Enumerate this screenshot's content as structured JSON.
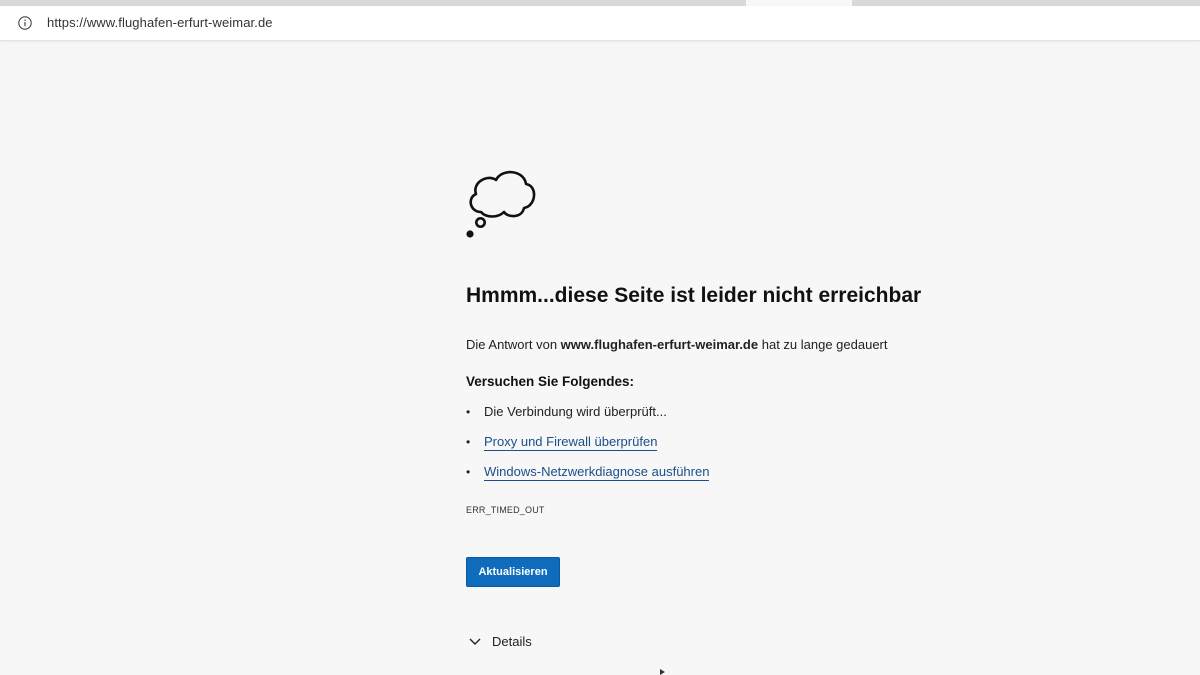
{
  "browser": {
    "url": "https://www.flughafen-erfurt-weimar.de",
    "info_icon": "info-circle-icon"
  },
  "error_page": {
    "icon": "thought-cloud-icon",
    "heading": "Hmmm...diese Seite ist leider nicht erreichbar",
    "message_prefix": "Die Antwort von",
    "message_host": "www.flughafen-erfurt-weimar.de",
    "message_suffix": "hat zu lange gedauert",
    "try_heading": "Versuchen Sie Folgendes:",
    "suggestions": [
      {
        "text": "Die Verbindung wird überprüft...",
        "link": false
      },
      {
        "text": "Proxy und Firewall überprüfen",
        "link": true
      },
      {
        "text": "Windows-Netzwerkdiagnose ausführen",
        "link": true
      }
    ],
    "error_code": "ERR_TIMED_OUT",
    "refresh_label": "Aktualisieren",
    "details_label": "Details",
    "accent_color": "#0f6cbd",
    "link_color": "#1a4f8a"
  }
}
